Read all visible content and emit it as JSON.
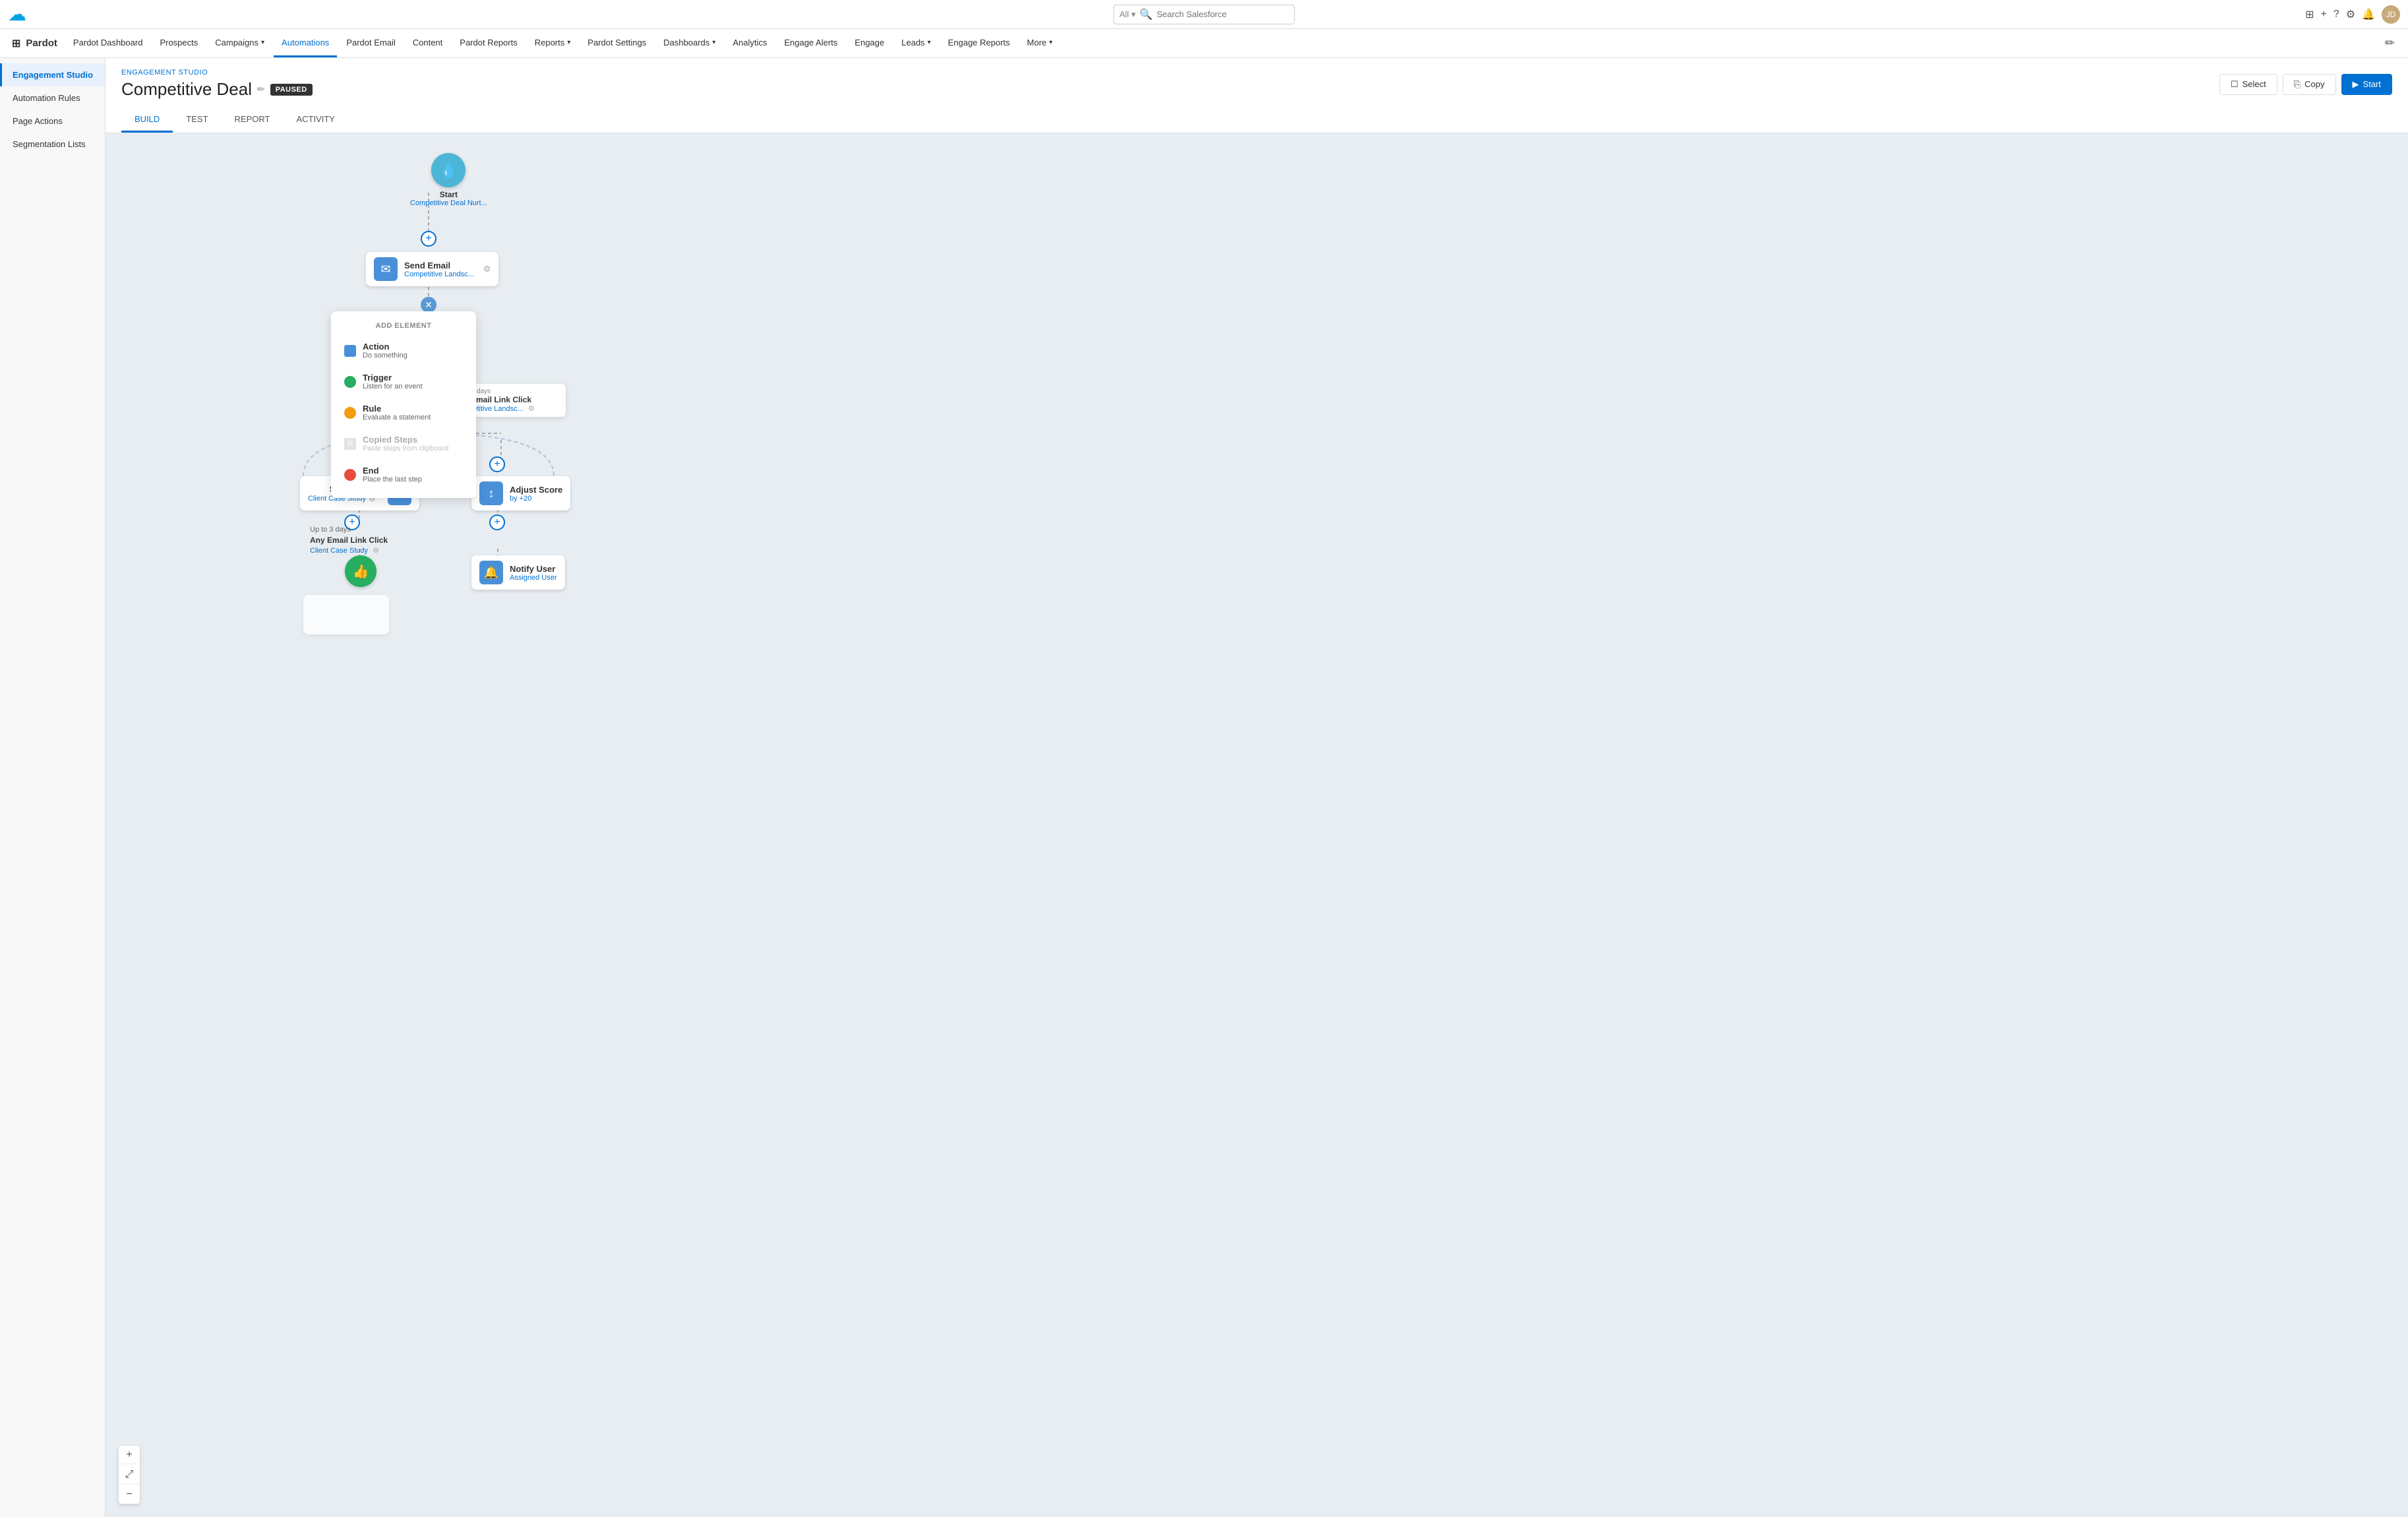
{
  "topbar": {
    "app_icon": "☁",
    "search_placeholder": "Search Salesforce",
    "search_filter": "All",
    "icons": [
      "grid",
      "plus",
      "question",
      "gear",
      "bell",
      "avatar"
    ],
    "avatar_initials": "JD"
  },
  "navbar": {
    "app_name": "Pardot",
    "items": [
      {
        "label": "Pardot Dashboard",
        "active": false
      },
      {
        "label": "Prospects",
        "active": false
      },
      {
        "label": "Campaigns",
        "active": false,
        "has_caret": true
      },
      {
        "label": "Automations",
        "active": true
      },
      {
        "label": "Pardot Email",
        "active": false
      },
      {
        "label": "Content",
        "active": false
      },
      {
        "label": "Pardot Reports",
        "active": false
      },
      {
        "label": "Reports",
        "active": false,
        "has_caret": true
      },
      {
        "label": "Pardot Settings",
        "active": false
      },
      {
        "label": "Dashboards",
        "active": false,
        "has_caret": true
      },
      {
        "label": "Analytics",
        "active": false
      },
      {
        "label": "Engage Alerts",
        "active": false
      },
      {
        "label": "Engage",
        "active": false
      },
      {
        "label": "Leads",
        "active": false,
        "has_caret": true
      },
      {
        "label": "Engage Reports",
        "active": false
      },
      {
        "label": "More",
        "active": false,
        "has_caret": true
      }
    ]
  },
  "sidebar": {
    "items": [
      {
        "label": "Engagement Studio",
        "active": true
      },
      {
        "label": "Automation Rules",
        "active": false
      },
      {
        "label": "Page Actions",
        "active": false
      },
      {
        "label": "Segmentation Lists",
        "active": false
      }
    ]
  },
  "page": {
    "breadcrumb": "ENGAGEMENT STUDIO",
    "title": "Competitive Deal",
    "status": "PAUSED",
    "actions": {
      "select_label": "Select",
      "copy_label": "Copy",
      "start_label": "Start"
    },
    "tabs": [
      {
        "label": "BUILD",
        "active": true
      },
      {
        "label": "TEST",
        "active": false
      },
      {
        "label": "REPORT",
        "active": false
      },
      {
        "label": "ACTIVITY",
        "active": false
      }
    ]
  },
  "flow": {
    "start_node": {
      "label": "Start",
      "sublabel": "Competitive Deal Nurt..."
    },
    "send_email_1": {
      "label": "Send Email",
      "sublabel": "Competitive Landsc..."
    },
    "add_element_panel": {
      "header": "ADD ELEMENT",
      "items": [
        {
          "type": "Action",
          "sub": "Do something",
          "color": "#4a90d9"
        },
        {
          "type": "Trigger",
          "sub": "Listen for an event",
          "color": "#27ae60"
        },
        {
          "type": "Rule",
          "sub": "Evaluate a statement",
          "color": "#f39c12"
        },
        {
          "type": "Copied Steps",
          "sub": "Paste steps from clipboard",
          "color": "#bbb",
          "disabled": true
        },
        {
          "type": "End",
          "sub": "Place the last step",
          "color": "#e74c3c"
        }
      ]
    },
    "trigger_1": {
      "days": "Up to 3 days",
      "label": "Any Email Link Click",
      "sublabel": "Competitive Landsc..."
    },
    "send_email_2": {
      "label": "Send Email",
      "sublabel": "Client Case Study"
    },
    "adjust_score": {
      "label": "Adjust Score",
      "sublabel": "by +20"
    },
    "trigger_2": {
      "days": "Up to 3 days",
      "label": "Any Email Link Click",
      "sublabel": "Client Case Study"
    },
    "notify_user": {
      "label": "Notify User",
      "sublabel": "Assigned User"
    }
  },
  "zoom": {
    "zoom_in": "+",
    "fit": "⤢",
    "zoom_out": "−"
  }
}
